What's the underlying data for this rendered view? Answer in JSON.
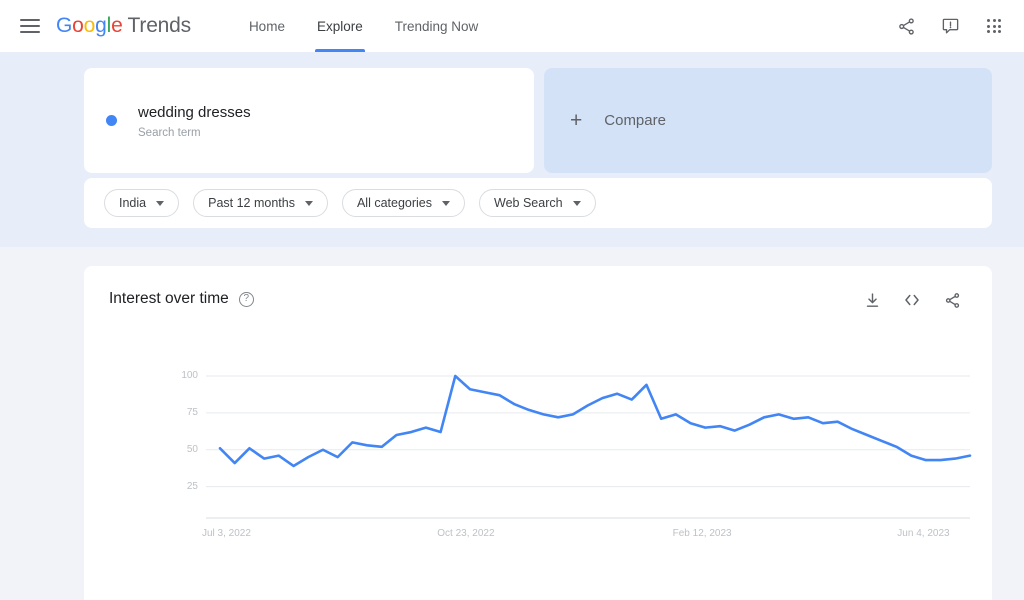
{
  "header": {
    "menu_icon": "hamburger-icon",
    "brand": {
      "g": "G",
      "o1": "o",
      "o2": "o",
      "g2": "g",
      "l": "l",
      "e": "e",
      "product": "Trends"
    },
    "nav": [
      {
        "label": "Home",
        "active": false
      },
      {
        "label": "Explore",
        "active": true
      },
      {
        "label": "Trending Now",
        "active": false
      }
    ],
    "actions": [
      {
        "icon": "share-icon",
        "label": "Share"
      },
      {
        "icon": "feedback-icon",
        "label": "Send feedback"
      },
      {
        "icon": "apps-grid-icon",
        "label": "Google apps"
      }
    ]
  },
  "search": {
    "term": "wedding dresses",
    "type_label": "Search term",
    "dot_color": "#4285f4",
    "compare_label": "Compare",
    "compare_plus": "+"
  },
  "filters": [
    {
      "name": "region",
      "label": "India"
    },
    {
      "name": "time-range",
      "label": "Past 12 months"
    },
    {
      "name": "category",
      "label": "All categories"
    },
    {
      "name": "search-type",
      "label": "Web Search"
    }
  ],
  "chart_card": {
    "title": "Interest over time",
    "help_glyph": "?",
    "tools": [
      {
        "icon": "download-icon",
        "label": "Download CSV"
      },
      {
        "icon": "embed-code-icon",
        "label": "Embed"
      },
      {
        "icon": "share-icon",
        "label": "Share"
      }
    ]
  },
  "chart_data": {
    "type": "line",
    "title": "Interest over time",
    "xlabel": "",
    "ylabel": "",
    "ylim": [
      0,
      100
    ],
    "yticks": [
      25,
      50,
      75,
      100
    ],
    "ytick_labels": [
      "25",
      "50",
      "75",
      "100"
    ],
    "xtick_labels": [
      "Jul 3, 2022",
      "Oct 23, 2022",
      "Feb 12, 2023",
      "Jun 4, 2023"
    ],
    "xtick_positions": [
      0,
      0.3137,
      0.6275,
      0.9804
    ],
    "grid": true,
    "legend": false,
    "line_color": "#4285f4",
    "series": [
      {
        "name": "wedding dresses",
        "values": [
          51,
          41,
          51,
          44,
          46,
          39,
          45,
          50,
          45,
          55,
          53,
          52,
          60,
          62,
          65,
          62,
          100,
          91,
          89,
          87,
          81,
          77,
          74,
          72,
          74,
          80,
          85,
          88,
          84,
          94,
          71,
          74,
          68,
          65,
          66,
          63,
          67,
          72,
          74,
          71,
          72,
          68,
          69,
          64,
          60,
          56,
          52,
          46,
          43,
          43,
          44,
          46
        ]
      }
    ]
  },
  "colors": {
    "accent": "#4285f4",
    "page_bg": "#f1f3f9",
    "band_bg": "#e8eef9",
    "compare_bg": "#d4e2f7",
    "card_bg": "#ffffff",
    "grid": "#e8eaed",
    "tick_text": "#bdc1c6"
  }
}
